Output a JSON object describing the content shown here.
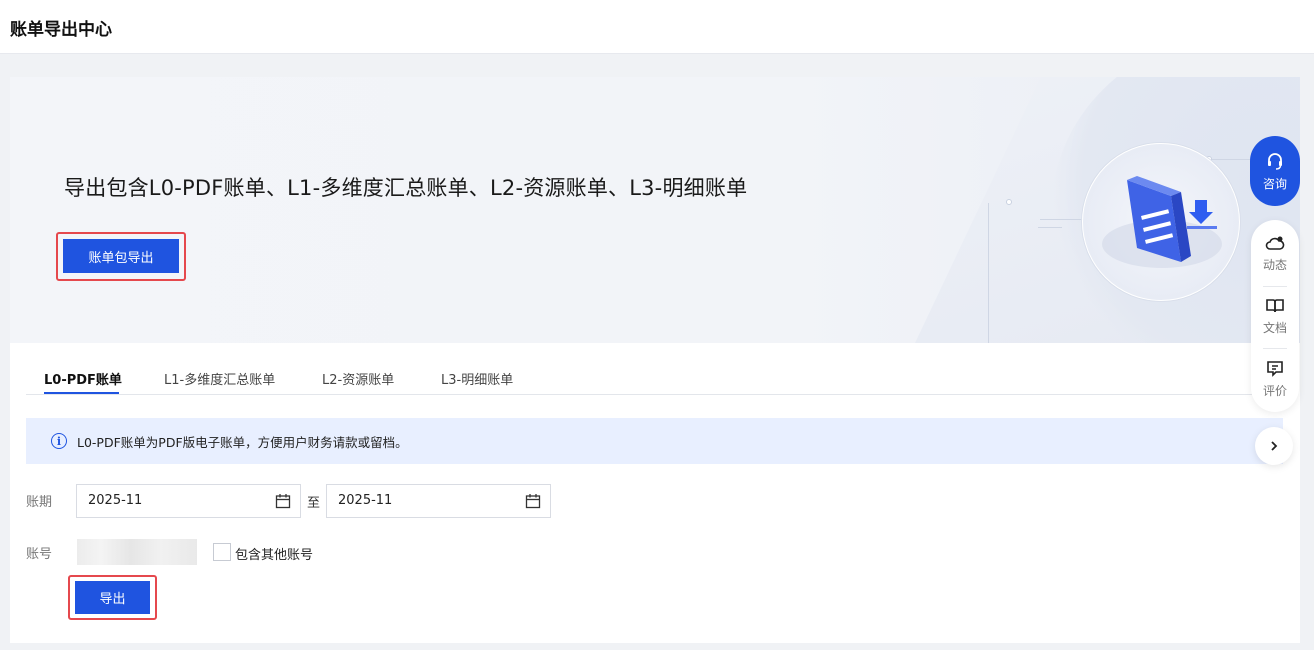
{
  "page": {
    "title": "账单导出中心"
  },
  "banner": {
    "title": "导出包含L0-PDF账单、L1-多维度汇总账单、L2-资源账单、L3-明细账单",
    "package_export_label": "账单包导出"
  },
  "tabs": [
    {
      "label": "L0-PDF账单",
      "active": true
    },
    {
      "label": "L1-多维度汇总账单",
      "active": false
    },
    {
      "label": "L2-资源账单",
      "active": false
    },
    {
      "label": "L3-明细账单",
      "active": false
    }
  ],
  "info": {
    "text": "L0-PDF账单为PDF版电子账单，方便用户财务请款或留档。"
  },
  "form": {
    "period_label": "账期",
    "start_value": "2025-11",
    "range_sep": "至",
    "end_value": "2025-11",
    "account_label": "账号",
    "include_other_label": "包含其他账号",
    "include_other_checked": false,
    "export_label": "导出"
  },
  "float_bar": {
    "consult_label": "咨询",
    "items": [
      {
        "label": "动态",
        "icon": "cloud-bell-icon"
      },
      {
        "label": "文档",
        "icon": "book-icon"
      },
      {
        "label": "评价",
        "icon": "comment-icon"
      }
    ],
    "expand_icon": "chevron-right-icon"
  },
  "colors": {
    "primary": "#1f54e0",
    "highlight": "#e5484d",
    "info_bg": "#e8efff"
  }
}
